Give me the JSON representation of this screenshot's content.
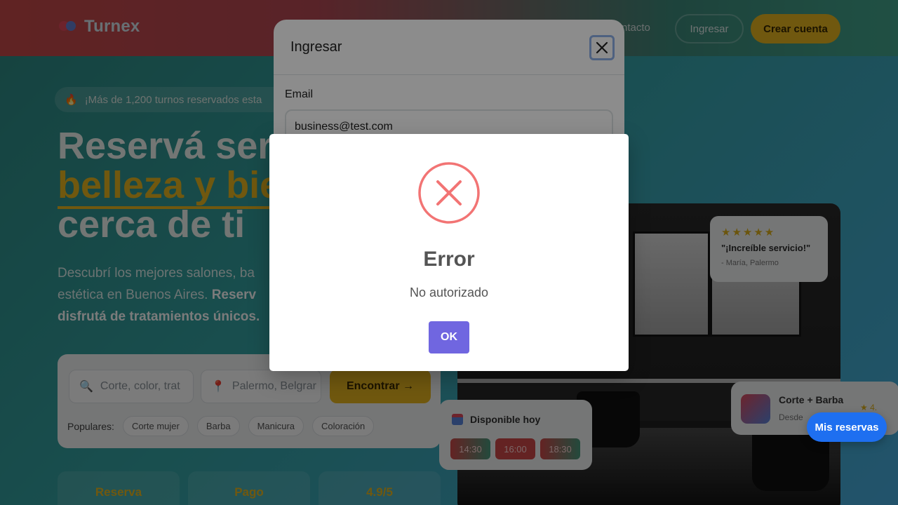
{
  "header": {
    "brand": "Turnex",
    "nav_contact": "ntacto",
    "login": "Ingresar",
    "create_account": "Crear cuenta"
  },
  "hero": {
    "announcement": "¡Más de 1,200 turnos reservados esta",
    "title_line1": "Reservá ser",
    "title_accent": "belleza y bie",
    "title_line3": "cerca de ti",
    "desc_line1": "Descubrí los mejores salones, ba",
    "desc_line2_plain": "estética en Buenos Aires. ",
    "desc_line2_bold": "Reserv",
    "desc_line3_bold": "disfrutá de tratamientos únicos."
  },
  "search": {
    "service_placeholder": "Corte, color, trat",
    "location_placeholder": "Palermo, Belgrar",
    "find_button": "Encontrar →",
    "popular_label": "Populares:",
    "popular_chips": [
      "Corte mujer",
      "Barba",
      "Manicura",
      "Coloración"
    ]
  },
  "stats": [
    "Reserva",
    "Pago",
    "4.9/5"
  ],
  "review": {
    "stars": "★★★★★",
    "quote": "\"¡Increíble servicio!\"",
    "author": "- María, Palermo"
  },
  "availability": {
    "title": "Disponible hoy",
    "slots": [
      "14:30",
      "16:00",
      "18:30"
    ]
  },
  "service_card": {
    "name": "Corte + Barba",
    "subtitle": "Desde",
    "rating": "★ 4."
  },
  "floating_button": "Mis reservas",
  "login_modal": {
    "title": "Ingresar",
    "email_label": "Email",
    "email_value": "business@test.com"
  },
  "error_dialog": {
    "title": "Error",
    "message": "No autorizado",
    "ok": "OK"
  },
  "colors": {
    "accent_yellow": "#e9b820",
    "error_red": "#f27474",
    "confirm_purple": "#7066e0",
    "primary_blue": "#1e6ff0"
  }
}
